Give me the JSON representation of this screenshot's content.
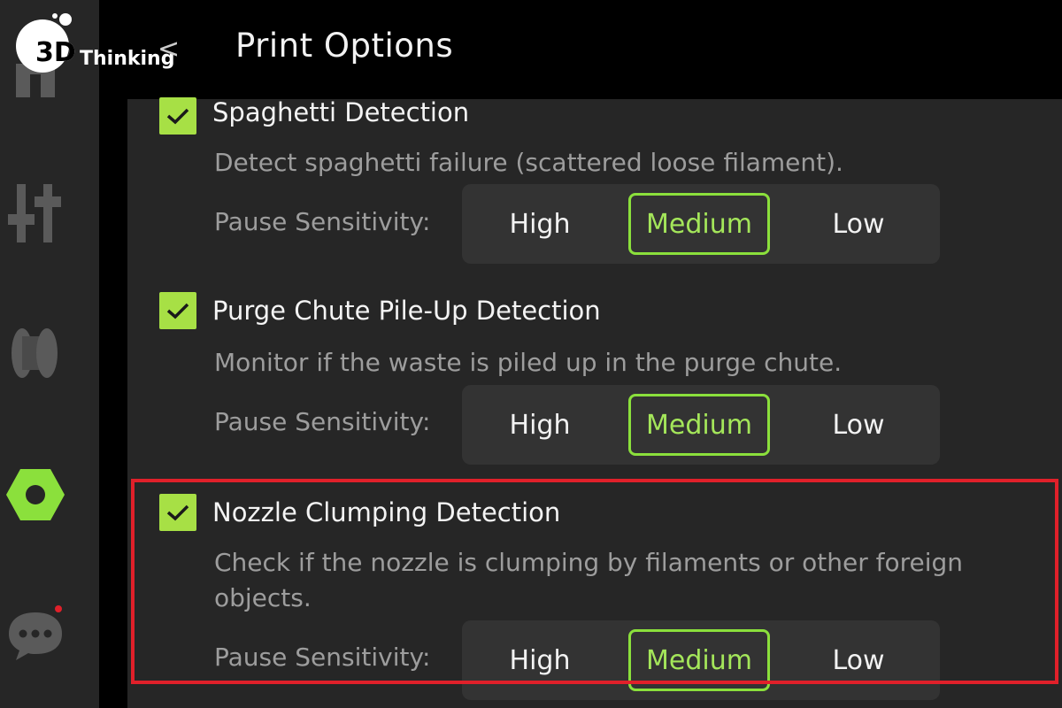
{
  "header": {
    "title": "Print Options",
    "logo_prefix": "3D",
    "logo_text": "Thinking",
    "back_glyph": "<"
  },
  "sidebar": {
    "icons": [
      "home-icon",
      "sliders-icon",
      "filament-spool-icon",
      "settings-nut-icon",
      "chat-icon"
    ],
    "active_color": "#8be03c",
    "notification_dot_color": "#e0202a"
  },
  "options": [
    {
      "title": "Spaghetti Detection",
      "description": "Detect spaghetti failure (scattered loose filament).",
      "checked": true,
      "sensitivity_label": "Pause Sensitivity:",
      "choices": [
        "High",
        "Medium",
        "Low"
      ],
      "selected": "Medium"
    },
    {
      "title": "Purge Chute Pile-Up Detection",
      "description": "Monitor if the waste is piled up in the purge chute.",
      "checked": true,
      "sensitivity_label": "Pause Sensitivity:",
      "choices": [
        "High",
        "Medium",
        "Low"
      ],
      "selected": "Medium"
    },
    {
      "title": "Nozzle Clumping Detection",
      "description": "Check if the nozzle is clumping by filaments or other foreign objects.",
      "checked": true,
      "sensitivity_label": "Pause Sensitivity:",
      "choices": [
        "High",
        "Medium",
        "Low"
      ],
      "selected": "Medium"
    }
  ],
  "colors": {
    "accent": "#a7e045",
    "highlight_box": "#e0202a"
  }
}
